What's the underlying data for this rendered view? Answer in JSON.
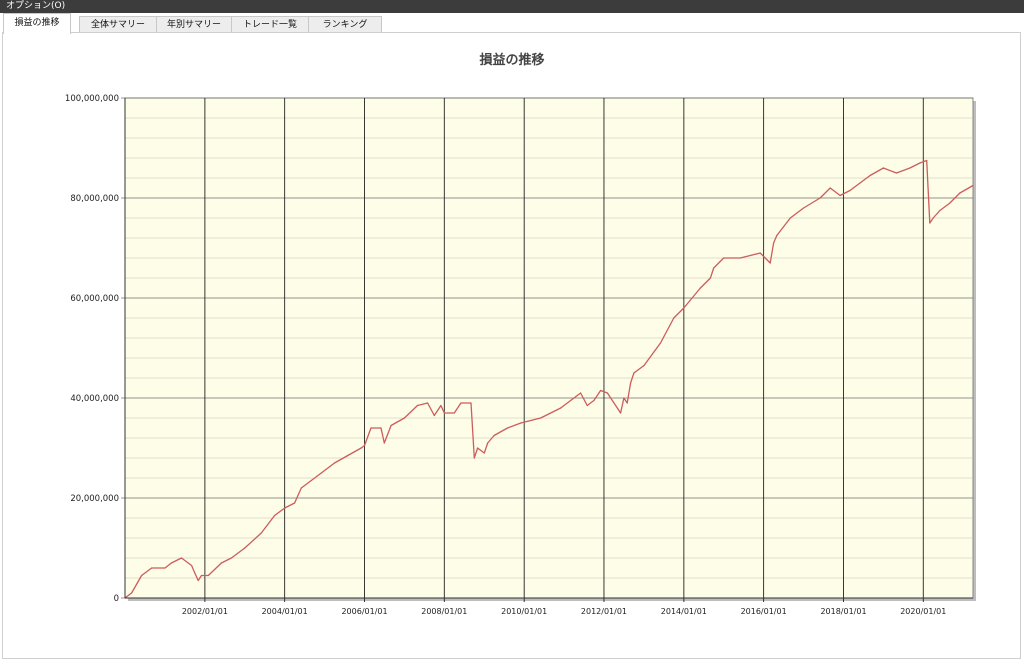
{
  "menubar": {
    "options_label": "オプション(O)"
  },
  "tabs": [
    {
      "label": "損益の推移",
      "active": true
    },
    {
      "label": "全体サマリー",
      "active": false
    },
    {
      "label": "年別サマリー",
      "active": false
    },
    {
      "label": "トレード一覧",
      "active": false
    },
    {
      "label": "ランキング",
      "active": false
    }
  ],
  "colors": {
    "plot_background": "#fdfde8",
    "line": "#cd5c5c",
    "menubar": "#3c3c3c"
  },
  "chart_data": {
    "type": "line",
    "title": "損益の推移",
    "xlabel": "",
    "ylabel": "",
    "xlim": [
      "2000-01-01",
      "2021-03-31"
    ],
    "ylim": [
      0,
      100000000
    ],
    "y_ticks": [
      0,
      20000000,
      40000000,
      60000000,
      80000000,
      100000000
    ],
    "y_tick_labels": [
      "0",
      "20,000,000",
      "40,000,000",
      "60,000,000",
      "80,000,000",
      "100,000,000"
    ],
    "x_ticks": [
      "2002-01-01",
      "2004-01-01",
      "2006-01-01",
      "2008-01-01",
      "2010-01-01",
      "2012-01-01",
      "2014-01-01",
      "2016-01-01",
      "2018-01-01",
      "2020-01-01"
    ],
    "x_tick_labels": [
      "2002/01/01",
      "2004/01/01",
      "2006/01/01",
      "2008/01/01",
      "2010/01/01",
      "2012/01/01",
      "2014/01/01",
      "2016/01/01",
      "2018/01/01",
      "2020/01/01"
    ],
    "grid": true,
    "series": [
      {
        "x": [
          "2000-01-01",
          "2000-03-01",
          "2000-06-01",
          "2000-09-01",
          "2001-01-01",
          "2001-03-01",
          "2001-06-01",
          "2001-09-01",
          "2001-10-01",
          "2001-11-01",
          "2001-12-01",
          "2002-02-01",
          "2002-06-01",
          "2002-09-01",
          "2003-01-01",
          "2003-06-01",
          "2003-10-01",
          "2004-01-01",
          "2004-04-01",
          "2004-06-01",
          "2004-09-01",
          "2004-12-01",
          "2005-04-01",
          "2005-08-01",
          "2005-12-01",
          "2006-01-01",
          "2006-03-01",
          "2006-06-01",
          "2006-07-01",
          "2006-09-01",
          "2007-01-01",
          "2007-05-01",
          "2007-08-01",
          "2007-10-01",
          "2007-12-01",
          "2008-01-01",
          "2008-04-01",
          "2008-06-01",
          "2008-09-01",
          "2008-10-01",
          "2008-11-01",
          "2009-01-01",
          "2009-02-01",
          "2009-04-01",
          "2009-08-01",
          "2009-12-01",
          "2010-06-01",
          "2010-12-01",
          "2011-06-01",
          "2011-08-01",
          "2011-10-01",
          "2011-12-01",
          "2012-02-01",
          "2012-06-01",
          "2012-07-01",
          "2012-08-01",
          "2012-09-01",
          "2012-10-01",
          "2013-01-01",
          "2013-06-01",
          "2013-10-01",
          "2014-01-01",
          "2014-06-01",
          "2014-09-01",
          "2014-10-01",
          "2015-01-01",
          "2015-06-01",
          "2015-09-01",
          "2015-12-01",
          "2016-03-01",
          "2016-04-01",
          "2016-05-01",
          "2016-09-01",
          "2017-01-01",
          "2017-06-01",
          "2017-09-01",
          "2017-12-01",
          "2018-03-01",
          "2018-06-01",
          "2018-09-01",
          "2019-01-01",
          "2019-05-01",
          "2019-09-01",
          "2019-12-01",
          "2020-02-01",
          "2020-03-01",
          "2020-04-01",
          "2020-06-01",
          "2020-09-01",
          "2020-12-01",
          "2021-03-31"
        ],
        "values": [
          0,
          1000000,
          4500000,
          6000000,
          6000000,
          7000000,
          8000000,
          6500000,
          5000000,
          3500000,
          4500000,
          4500000,
          7000000,
          8000000,
          10000000,
          13000000,
          16500000,
          18000000,
          19000000,
          22000000,
          23500000,
          25000000,
          27000000,
          28500000,
          30000000,
          30500000,
          34000000,
          34000000,
          31000000,
          34500000,
          36000000,
          38500000,
          39000000,
          36500000,
          38500000,
          37000000,
          37000000,
          39000000,
          39000000,
          28000000,
          30000000,
          29000000,
          31000000,
          32500000,
          34000000,
          35000000,
          36000000,
          38000000,
          41000000,
          38500000,
          39500000,
          41500000,
          41000000,
          37000000,
          40000000,
          39000000,
          43000000,
          45000000,
          46500000,
          51000000,
          56000000,
          58000000,
          62000000,
          64000000,
          66000000,
          68000000,
          68000000,
          68500000,
          69000000,
          67000000,
          71000000,
          72500000,
          76000000,
          78000000,
          80000000,
          82000000,
          80500000,
          81500000,
          83000000,
          84500000,
          86000000,
          85000000,
          86000000,
          87000000,
          87500000,
          75000000,
          76000000,
          77500000,
          79000000,
          81000000,
          82500000
        ]
      }
    ]
  }
}
